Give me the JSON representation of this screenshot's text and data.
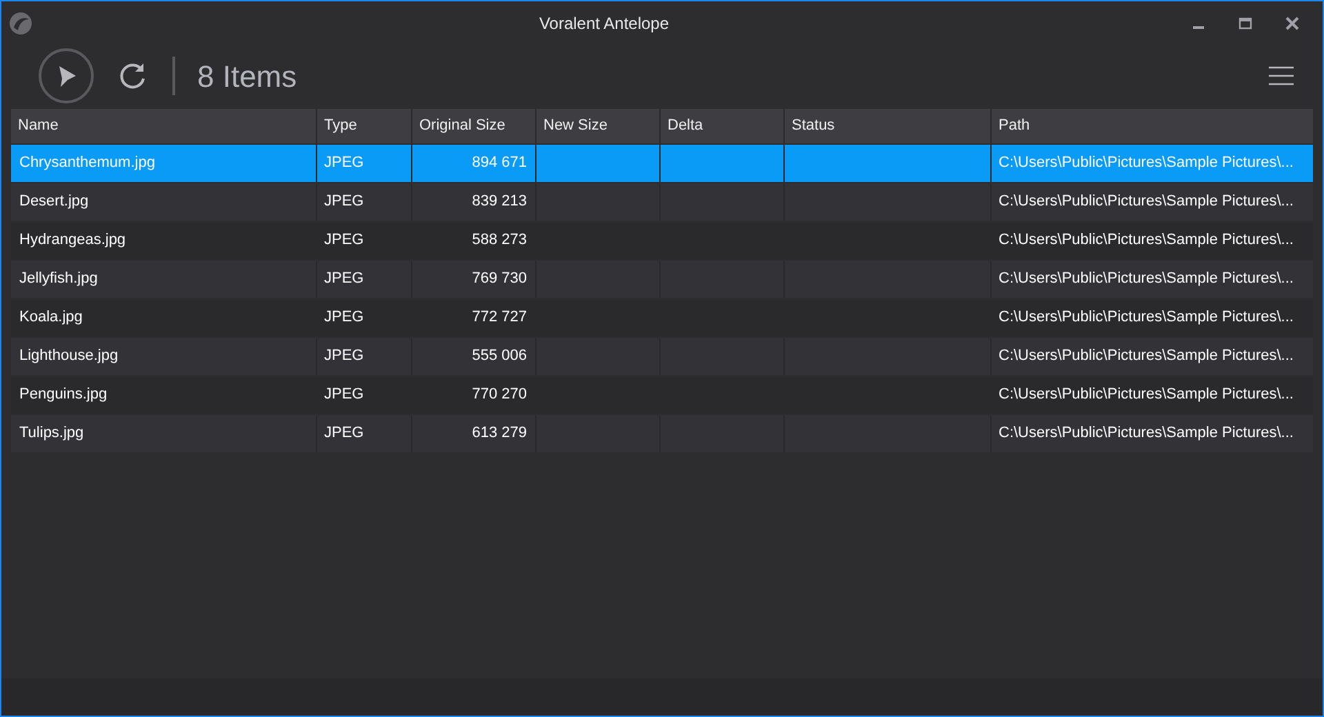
{
  "window": {
    "title": "Voralent Antelope"
  },
  "toolbar": {
    "count": "8 Items"
  },
  "table": {
    "columns": [
      "Name",
      "Type",
      "Original Size",
      "New Size",
      "Delta",
      "Status",
      "Path"
    ],
    "rows": [
      {
        "selected": true,
        "cells": [
          "Chrysanthemum.jpg",
          "JPEG",
          "894 671",
          "",
          "",
          "",
          "C:\\Users\\Public\\Pictures\\Sample Pictures\\..."
        ]
      },
      {
        "selected": false,
        "cells": [
          "Desert.jpg",
          "JPEG",
          "839 213",
          "",
          "",
          "",
          "C:\\Users\\Public\\Pictures\\Sample Pictures\\..."
        ]
      },
      {
        "selected": false,
        "cells": [
          "Hydrangeas.jpg",
          "JPEG",
          "588 273",
          "",
          "",
          "",
          "C:\\Users\\Public\\Pictures\\Sample Pictures\\..."
        ]
      },
      {
        "selected": false,
        "cells": [
          "Jellyfish.jpg",
          "JPEG",
          "769 730",
          "",
          "",
          "",
          "C:\\Users\\Public\\Pictures\\Sample Pictures\\..."
        ]
      },
      {
        "selected": false,
        "cells": [
          "Koala.jpg",
          "JPEG",
          "772 727",
          "",
          "",
          "",
          "C:\\Users\\Public\\Pictures\\Sample Pictures\\..."
        ]
      },
      {
        "selected": false,
        "cells": [
          "Lighthouse.jpg",
          "JPEG",
          "555 006",
          "",
          "",
          "",
          "C:\\Users\\Public\\Pictures\\Sample Pictures\\..."
        ]
      },
      {
        "selected": false,
        "cells": [
          "Penguins.jpg",
          "JPEG",
          "770 270",
          "",
          "",
          "",
          "C:\\Users\\Public\\Pictures\\Sample Pictures\\..."
        ]
      },
      {
        "selected": false,
        "cells": [
          "Tulips.jpg",
          "JPEG",
          "613 279",
          "",
          "",
          "",
          "C:\\Users\\Public\\Pictures\\Sample Pictures\\..."
        ]
      }
    ]
  }
}
